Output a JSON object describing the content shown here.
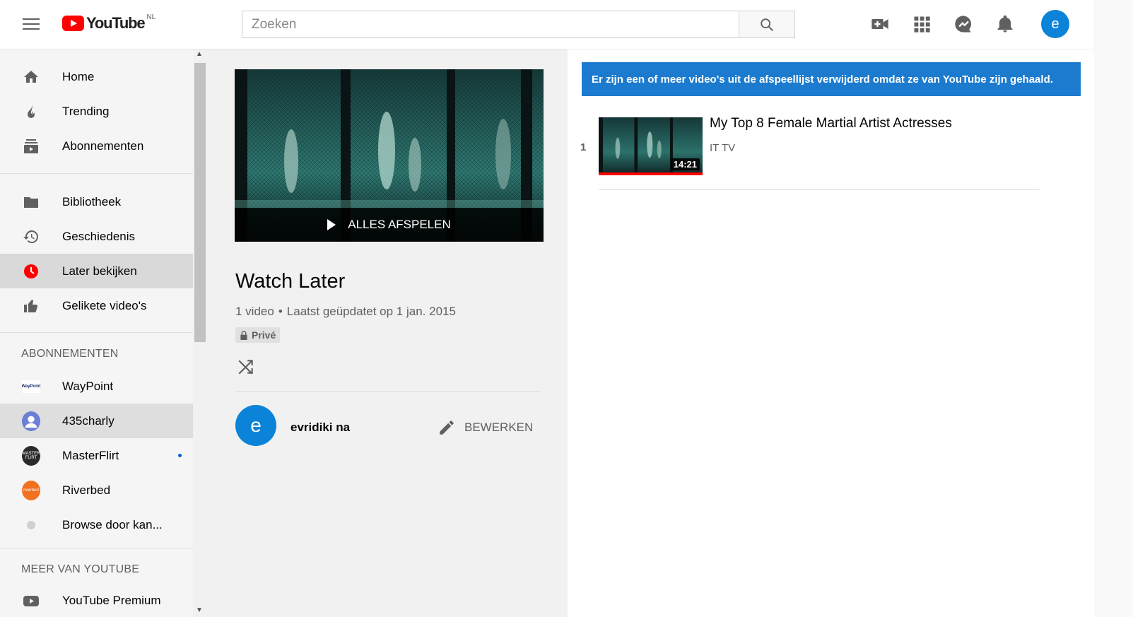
{
  "header": {
    "logo_text": "YouTube",
    "country": "NL",
    "search_placeholder": "Zoeken",
    "avatar_letter": "e"
  },
  "sidebar": {
    "primary": [
      {
        "label": "Home",
        "icon": "home-icon"
      },
      {
        "label": "Trending",
        "icon": "flame-icon"
      },
      {
        "label": "Abonnementen",
        "icon": "subscriptions-icon"
      }
    ],
    "library": [
      {
        "label": "Bibliotheek",
        "icon": "folder-icon"
      },
      {
        "label": "Geschiedenis",
        "icon": "history-icon"
      },
      {
        "label": "Later bekijken",
        "icon": "clock-icon",
        "active": true
      },
      {
        "label": "Gelikete video's",
        "icon": "thumbs-up-icon"
      }
    ],
    "subscriptions_heading": "ABONNEMENTEN",
    "subscriptions": [
      {
        "label": "WayPoint",
        "avatar_text": "WayPoint"
      },
      {
        "label": "435charly"
      },
      {
        "label": "MasterFlirt",
        "avatar_text": "MASTER FLIRT",
        "new": true
      },
      {
        "label": "Riverbed",
        "avatar_text": "riverbed"
      },
      {
        "label": "Browse door kan..."
      }
    ],
    "more_heading": "MEER VAN YOUTUBE",
    "more": [
      {
        "label": "YouTube Premium",
        "icon": "youtube-icon"
      }
    ]
  },
  "playlist": {
    "play_all_label": "ALLES AFSPELEN",
    "title": "Watch Later",
    "video_count": "1 video",
    "updated": "Laatst geüpdatet op 1 jan. 2015",
    "privacy": "Privé",
    "owner_letter": "e",
    "owner_name": "evridiki na",
    "edit_label": "BEWERKEN"
  },
  "content": {
    "alert": "Er zijn een of meer video's uit de afspeellijst verwijderd omdat ze van YouTube zijn gehaald.",
    "videos": [
      {
        "index": "1",
        "title": "My Top 8 Female Martial Artist Actresses",
        "channel": "IT TV",
        "duration": "14:21",
        "watched_fraction": 1.0
      }
    ]
  },
  "colors": {
    "brand_red": "#ff0000",
    "alert_blue": "#1c7bce",
    "avatar_blue": "#0b83d9"
  }
}
